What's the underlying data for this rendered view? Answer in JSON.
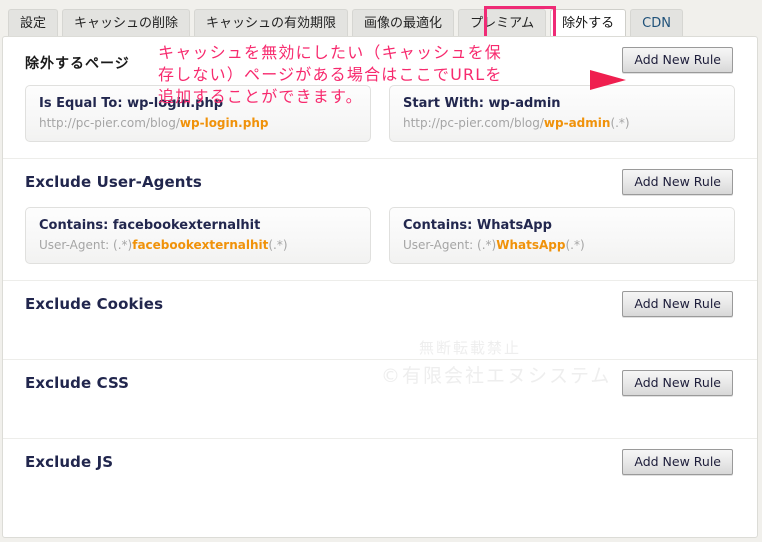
{
  "tabs": [
    {
      "label": "設定",
      "active": false
    },
    {
      "label": "キャッシュの削除",
      "active": false
    },
    {
      "label": "キャッシュの有効期限",
      "active": false
    },
    {
      "label": "画像の最適化",
      "active": false
    },
    {
      "label": "プレミアム",
      "active": false
    },
    {
      "label": "除外する",
      "active": true
    },
    {
      "label": "CDN",
      "active": false
    }
  ],
  "annotation": {
    "line1": "キャッシュを無効にしたい（キャッシュを保",
    "line2": "存しない）ページがある場合はここでURLを",
    "line3": "追加することができます。",
    "color": "#f72a6e",
    "arrow": "arrow-right-icon"
  },
  "watermark": {
    "line1": "無断転載禁止",
    "line2": "©有限会社エヌシステム"
  },
  "add_button_label": "Add New Rule",
  "sections": [
    {
      "title": "除外するページ",
      "rules": [
        {
          "title": "Is Equal To: wp-login.php",
          "prefix": "http://pc-pier.com/blog/",
          "highlight": "wp-login.php",
          "suffix": ""
        },
        {
          "title": "Start With: wp-admin",
          "prefix": "http://pc-pier.com/blog/",
          "highlight": "wp-admin",
          "suffix": "(.*)"
        }
      ]
    },
    {
      "title": "Exclude User-Agents",
      "rules": [
        {
          "title": "Contains: facebookexternalhit",
          "prefix": "User-Agent: (.*)",
          "highlight": "facebookexternalhit",
          "suffix": "(.*)"
        },
        {
          "title": "Contains: WhatsApp",
          "prefix": "User-Agent: (.*)",
          "highlight": "WhatsApp",
          "suffix": "(.*)"
        }
      ]
    },
    {
      "title": "Exclude Cookies",
      "rules": []
    },
    {
      "title": "Exclude CSS",
      "rules": []
    },
    {
      "title": "Exclude JS",
      "rules": []
    }
  ],
  "colors": {
    "accent_pink": "#ef2b76",
    "heading_navy": "#21264d",
    "highlight_orange": "#f0920a",
    "page_bg": "#f1f0ec"
  }
}
